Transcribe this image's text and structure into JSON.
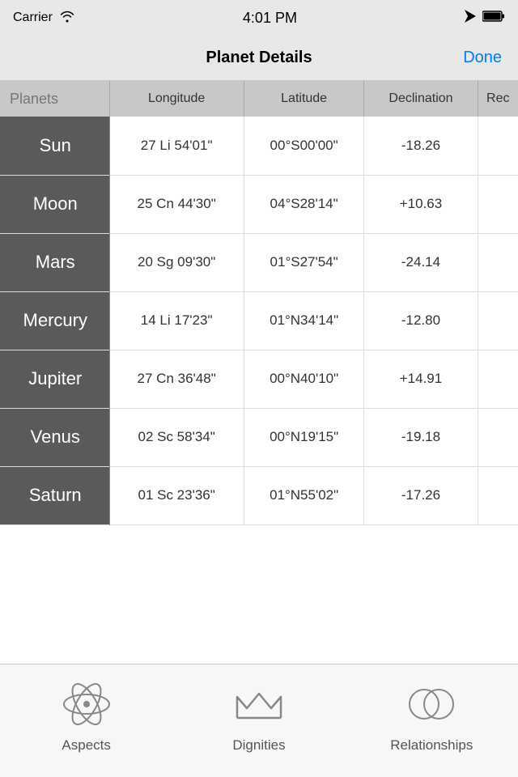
{
  "statusBar": {
    "carrier": "Carrier",
    "time": "4:01 PM"
  },
  "navBar": {
    "title": "Planet Details",
    "doneLabel": "Done"
  },
  "table": {
    "headers": [
      "Planets",
      "Longitude",
      "Latitude",
      "Declination",
      "Rec"
    ],
    "rows": [
      {
        "planet": "Sun",
        "longitude": "27 Li 54'01\"",
        "latitude": "00°S00'00\"",
        "declination": "-18.26",
        "rec": ""
      },
      {
        "planet": "Moon",
        "longitude": "25 Cn 44'30\"",
        "latitude": "04°S28'14\"",
        "declination": "+10.63",
        "rec": ""
      },
      {
        "planet": "Mars",
        "longitude": "20 Sg 09'30\"",
        "latitude": "01°S27'54\"",
        "declination": "-24.14",
        "rec": ""
      },
      {
        "planet": "Mercury",
        "longitude": "14 Li 17'23\"",
        "latitude": "01°N34'14\"",
        "declination": "-12.80",
        "rec": ""
      },
      {
        "planet": "Jupiter",
        "longitude": "27 Cn 36'48\"",
        "latitude": "00°N40'10\"",
        "declination": "+14.91",
        "rec": ""
      },
      {
        "planet": "Venus",
        "longitude": "02 Sc 58'34\"",
        "latitude": "00°N19'15\"",
        "declination": "-19.18",
        "rec": ""
      },
      {
        "planet": "Saturn",
        "longitude": "01 Sc 23'36\"",
        "latitude": "01°N55'02\"",
        "declination": "-17.26",
        "rec": ""
      }
    ]
  },
  "tabBar": {
    "items": [
      {
        "id": "aspects",
        "label": "Aspects"
      },
      {
        "id": "dignities",
        "label": "Dignities"
      },
      {
        "id": "relationships",
        "label": "Relationships"
      }
    ]
  }
}
